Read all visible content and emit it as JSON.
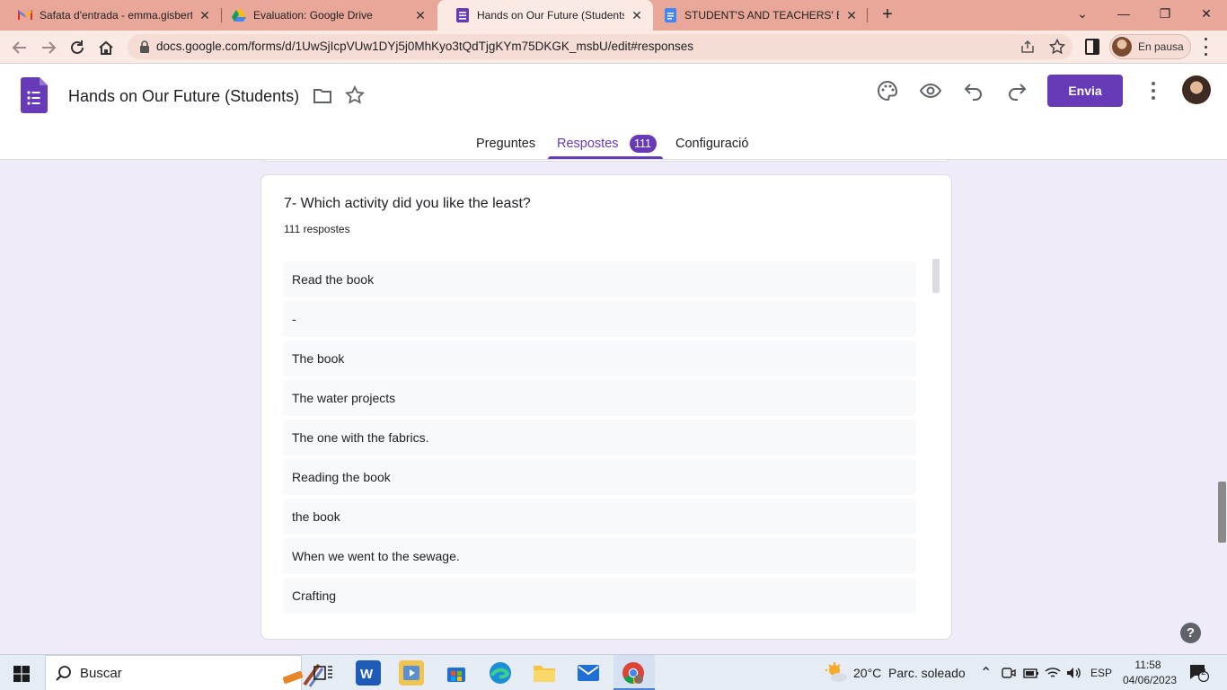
{
  "browser": {
    "tabs": [
      {
        "title": "Safata d'entrada - emma.gisbert@",
        "icon": "gmail-icon"
      },
      {
        "title": "Evaluation: Google Drive",
        "icon": "drive-icon"
      },
      {
        "title": "Hands on Our Future (Students) -",
        "icon": "forms-icon",
        "active": true
      },
      {
        "title": "STUDENT'S AND TEACHERS' EVAL",
        "icon": "docs-icon"
      }
    ],
    "url": "docs.google.com/forms/d/1UwSjIcpVUw1DYj5j0MhKyo3tQdTjgKYm75DKGK_msbU/edit#responses",
    "profile_status": "En pausa"
  },
  "form": {
    "title": "Hands on Our Future (Students)",
    "send_label": "Envia",
    "tabs": {
      "questions": "Preguntes",
      "responses": "Respostes",
      "responses_count": "111",
      "settings": "Configuració"
    }
  },
  "question": {
    "title": "7- Which activity did you like the least?",
    "count_label": "111 respostes",
    "responses": [
      "Read the book",
      "-",
      "The book",
      "The water projects",
      "The one with the fabrics.",
      "Reading the book",
      "the book",
      "When we went to the sewage.",
      "Crafting"
    ]
  },
  "taskbar": {
    "search_label": "Buscar",
    "weather": "20°C  Parc. soleado",
    "language": "ESP",
    "time": "11:58",
    "date": "04/06/2023",
    "notifications": "2"
  },
  "colors": {
    "accent": "#673ab7",
    "page_bg": "#f0ebf8",
    "tab_strip": "#e8a799"
  }
}
